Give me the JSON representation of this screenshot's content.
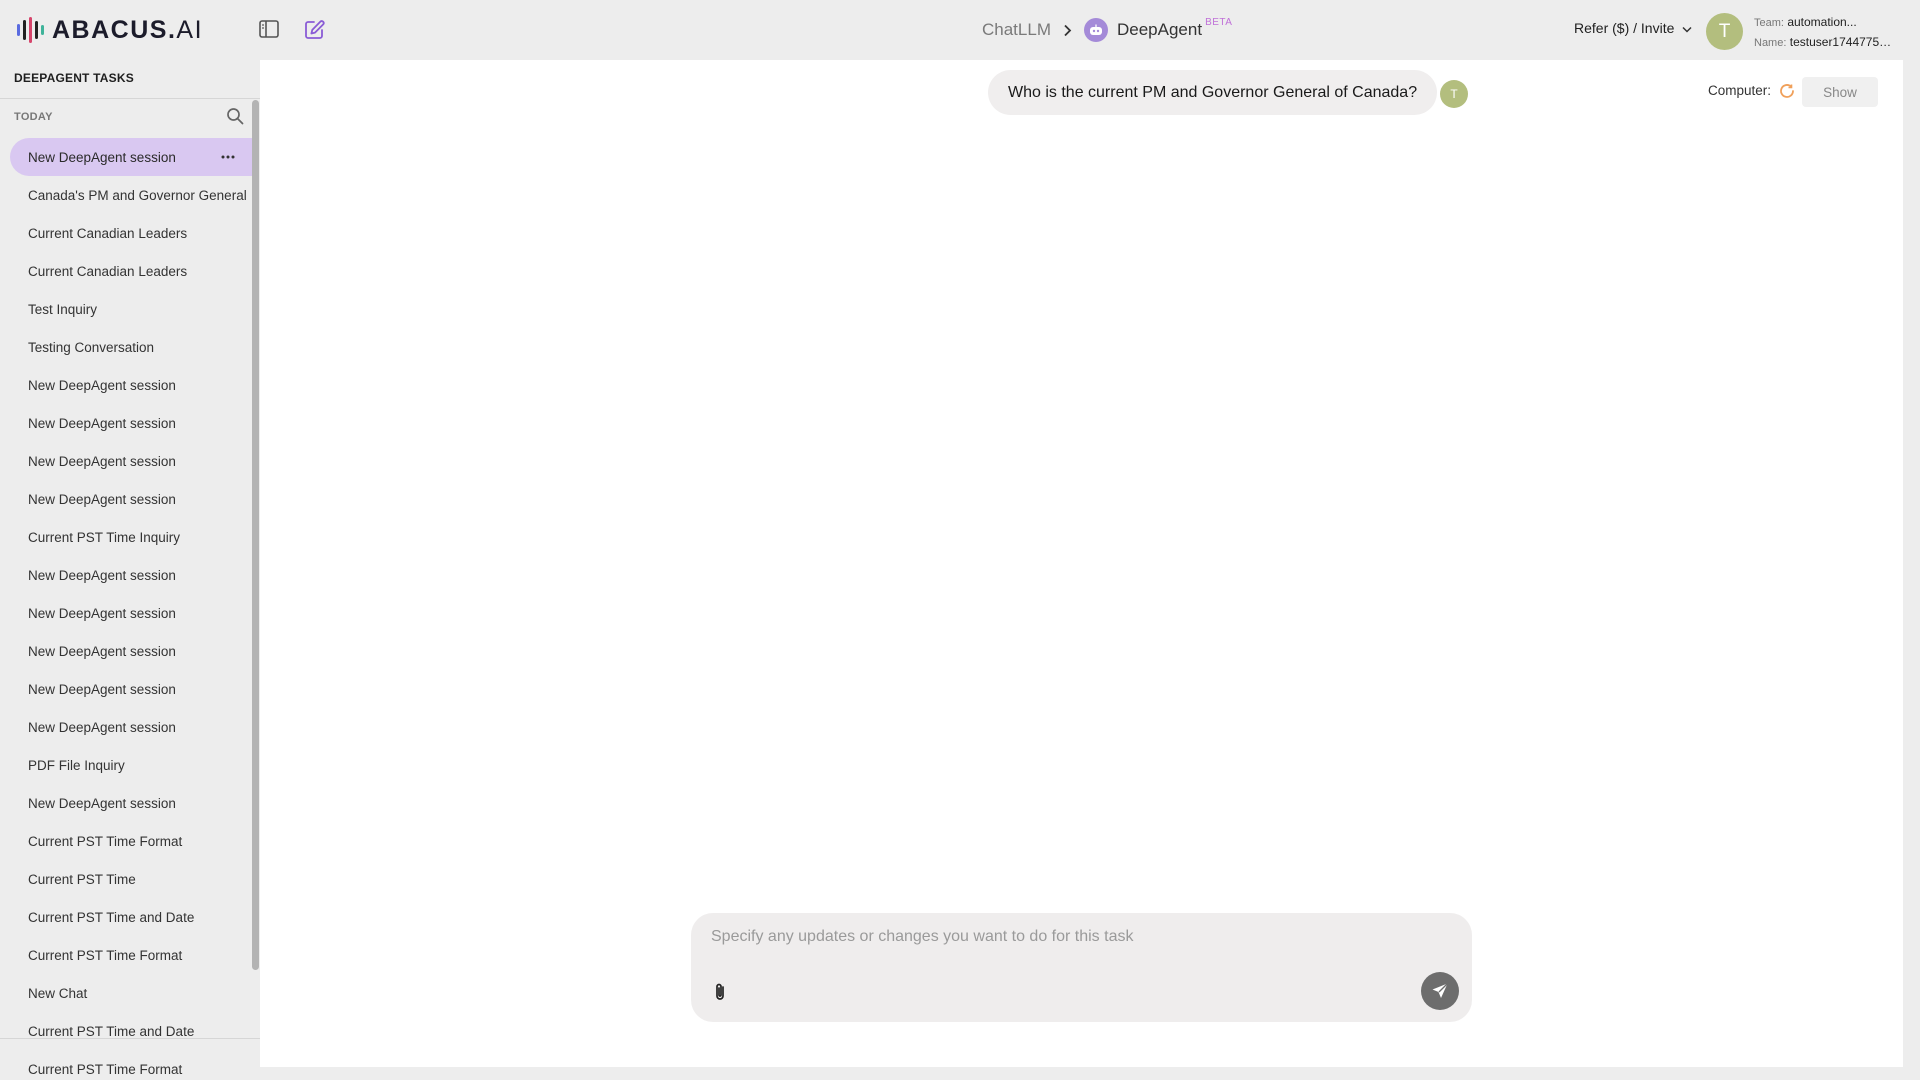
{
  "header": {
    "logo_text_main": "ABACUS.",
    "logo_text_ai": "AI",
    "breadcrumb_root": "ChatLLM",
    "breadcrumb_current": "DeepAgent",
    "beta_label": "BETA",
    "refer_label": "Refer ($) / Invite",
    "user_initial": "T",
    "team_key": "Team:",
    "team_value": "automation...",
    "name_key": "Name:",
    "name_value": "testuser1744775…"
  },
  "sidebar": {
    "title": "DEEPAGENT TASKS",
    "section_label": "TODAY",
    "items": [
      {
        "label": "New DeepAgent session",
        "active": true
      },
      {
        "label": "Canada's PM and Governor General"
      },
      {
        "label": "Current Canadian Leaders"
      },
      {
        "label": "Current Canadian Leaders"
      },
      {
        "label": "Test Inquiry"
      },
      {
        "label": "Testing Conversation"
      },
      {
        "label": "New DeepAgent session"
      },
      {
        "label": "New DeepAgent session"
      },
      {
        "label": "New DeepAgent session"
      },
      {
        "label": "New DeepAgent session"
      },
      {
        "label": "Current PST Time Inquiry"
      },
      {
        "label": "New DeepAgent session"
      },
      {
        "label": "New DeepAgent session"
      },
      {
        "label": "New DeepAgent session"
      },
      {
        "label": "New DeepAgent session"
      },
      {
        "label": "New DeepAgent session"
      },
      {
        "label": "PDF File Inquiry"
      },
      {
        "label": "New DeepAgent session"
      },
      {
        "label": "Current PST Time Format"
      },
      {
        "label": "Current PST Time"
      },
      {
        "label": "Current PST Time and Date"
      },
      {
        "label": "Current PST Time Format"
      },
      {
        "label": "New Chat"
      },
      {
        "label": "Current PST Time and Date"
      },
      {
        "label": "Current PST Time Format"
      }
    ]
  },
  "chat": {
    "user_message": "Who is the current PM and Governor General of Canada?",
    "user_initial": "T",
    "computer_label": "Computer:",
    "show_label": "Show"
  },
  "composer": {
    "placeholder": "Specify any updates or changes you want to do for this task",
    "value": ""
  },
  "colors": {
    "accent": "#d9c8f1",
    "edit_icon": "#8a5cd6",
    "spinner": "#f0a05a",
    "avatar": "#b3be7e"
  }
}
